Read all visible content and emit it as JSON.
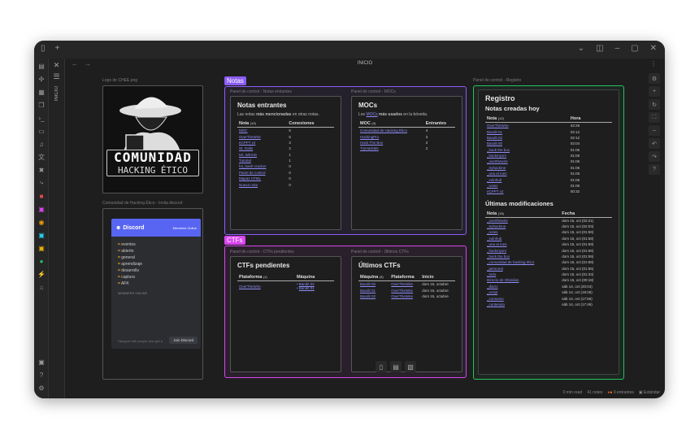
{
  "window": {
    "tab_title": "INICIO",
    "sidebar_vertical_label": "INICIO"
  },
  "captions": {
    "logo": "Logo de CHEE.png",
    "discord": "Comunidad de Hacking Ético - Invita discord",
    "registro": "Panel de control - Registro",
    "notas_entrantes": "Panel de control - Notas entrantes",
    "mocs": "Panel de control - MOCs",
    "ctfs_pendientes": "Panel de control - CTFs pendientes",
    "ultimos_ctfs": "Panel de control - Últimos CTFs"
  },
  "groups": {
    "notas": "Notas",
    "ctfs": "CTFs"
  },
  "logo": {
    "line1": "COMUNIDAD",
    "line2": "HACKING ÉTICO"
  },
  "discord": {
    "name": "Discord",
    "online": "Members Online",
    "channels": [
      "eventos",
      "abierto",
      "general",
      "aprendizaje",
      "desarrollo",
      "captura",
      "AFK"
    ],
    "members_label": "MEMBERS ONLINE",
    "footer": "Hangout with people who get it",
    "join": "Join Discord"
  },
  "notas_entrantes": {
    "title": "Notas entrantes",
    "desc_pre": "Las notas ",
    "desc_bold": "más mencionadas",
    "desc_post": " en otras notas.",
    "col1": "Nota",
    "col1_count": "(10)",
    "col2": "Conexiones",
    "rows": [
      {
        "nota": "MOC",
        "con": "5"
      },
      {
        "nota": "OverTheWire",
        "con": "5"
      },
      {
        "nota": "eCPPT v2",
        "con": "3"
      },
      {
        "nota": "St. Gallo",
        "con": "2"
      },
      {
        "nota": "Mr. WEXIS",
        "con": "1"
      },
      {
        "nota": "Tutorial",
        "con": "1"
      },
      {
        "nota": "h4_hash-cracker",
        "con": "0"
      },
      {
        "nota": "Panel de control",
        "con": "0"
      },
      {
        "nota": "Mapas HTML",
        "con": "0"
      },
      {
        "nota": "Nueva nota",
        "con": "0"
      }
    ]
  },
  "mocs": {
    "title": "MOCs",
    "desc_pre": "Los ",
    "desc_link": "MOCs",
    "desc_bold": " más usados",
    "desc_post": " en la bóveda.",
    "col1": "MOC",
    "col1_count": "(4)",
    "col2": "Entrantes",
    "rows": [
      {
        "moc": "Comunidad de Hacking Ético",
        "n": "4"
      },
      {
        "moc": "HackingPro",
        "n": "3"
      },
      {
        "moc": "Hack The Box",
        "n": "2"
      },
      {
        "moc": "TryHackMe",
        "n": "2"
      }
    ]
  },
  "ctfs_pendientes": {
    "title": "CTFs pendientes",
    "col1": "Plataforma",
    "col1_count": "(1)",
    "col2": "Máquina",
    "platform": "OverTheWire",
    "machines": [
      "Bandit 02",
      "Bandit 01"
    ]
  },
  "ultimos_ctfs": {
    "title": "Últimos CTFs",
    "col1": "Máquina",
    "col1_count": "(3)",
    "col2": "Plataforma",
    "col3": "Inicio",
    "rows": [
      {
        "m": "Bandit 00",
        "p": "OverTheWire",
        "i": "dom 15, octubre"
      },
      {
        "m": "Bandit 01",
        "p": "OverTheWire",
        "i": "dom 15, octubre"
      },
      {
        "m": "Bandit 02",
        "p": "OverTheWire",
        "i": "dom 15, octubre"
      }
    ]
  },
  "registro": {
    "title": "Registro",
    "sub1": "Notas creadas hoy",
    "col1": "Nota",
    "col1_count": "(12)",
    "col2": "Hora",
    "created": [
      {
        "n": "OverTheWire",
        "h": "02:28"
      },
      {
        "n": "Bandit 01",
        "h": "02:12"
      },
      {
        "n": "Bandit 02",
        "h": "02:12"
      },
      {
        "n": "Bandit 00",
        "h": "02:04"
      },
      {
        "n": "_hack the box",
        "h": "01:06"
      },
      {
        "n": "_hackmyvm",
        "h": "01:06"
      },
      {
        "n": "_overthewire",
        "h": "01:06"
      },
      {
        "n": "_tryhackme",
        "h": "01:06"
      },
      {
        "n": "_una al mes",
        "h": "01:06"
      },
      {
        "n": "_vulnhub",
        "h": "01:06"
      },
      {
        "n": "_notes",
        "h": "01:06"
      },
      {
        "n": "eCPPT v2",
        "h": "00:32"
      }
    ],
    "sub2": "Últimas modificaciones",
    "mcol1": "Nota",
    "mcol1_count": "(15)",
    "mcol2": "Fecha",
    "modified": [
      {
        "n": "_overthewire",
        "f": "dom 15, oct (02:21)"
      },
      {
        "n": "_tryhackme",
        "f": "dom 15, oct (02:03)"
      },
      {
        "n": "_notes",
        "f": "dom 15, oct (01:59)"
      },
      {
        "n": "_vulnhub",
        "f": "dom 15, oct (01:59)"
      },
      {
        "n": "_una al mes",
        "f": "dom 15, oct (01:59)"
      },
      {
        "n": "_hackmyvm",
        "f": "dom 15, oct (01:59)"
      },
      {
        "n": "_hack the box",
        "f": "dom 15, oct (01:59)"
      },
      {
        "n": "_comunidad de hacking ético",
        "f": "dom 15, oct (01:58)"
      },
      {
        "n": "_personal",
        "f": "dom 15, oct (01:55)"
      },
      {
        "n": "_todo",
        "f": "dom 15, oct (01:33)"
      },
      {
        "n": "Directo de Obsidian",
        "f": "dom 15, oct (00:18)"
      },
      {
        "n": "_diario",
        "f": "sáb 14, oct (20:04)"
      },
      {
        "n": "_script",
        "f": "sáb 14, oct (19:25)"
      },
      {
        "n": "_consumo",
        "f": "sáb 14, oct (17:56)"
      },
      {
        "n": "_contenido",
        "f": "sáb 14, oct (17:49)"
      }
    ]
  },
  "status": {
    "read": "0 min read",
    "notes": "41 notes",
    "entrantes": "0 entrantes",
    "mode": "Estándar"
  },
  "colors": {
    "notas_group": "#8b5cf6",
    "ctfs_group": "#d946ef",
    "registro_group": "#22c55e",
    "link": "#8f8cf6"
  }
}
